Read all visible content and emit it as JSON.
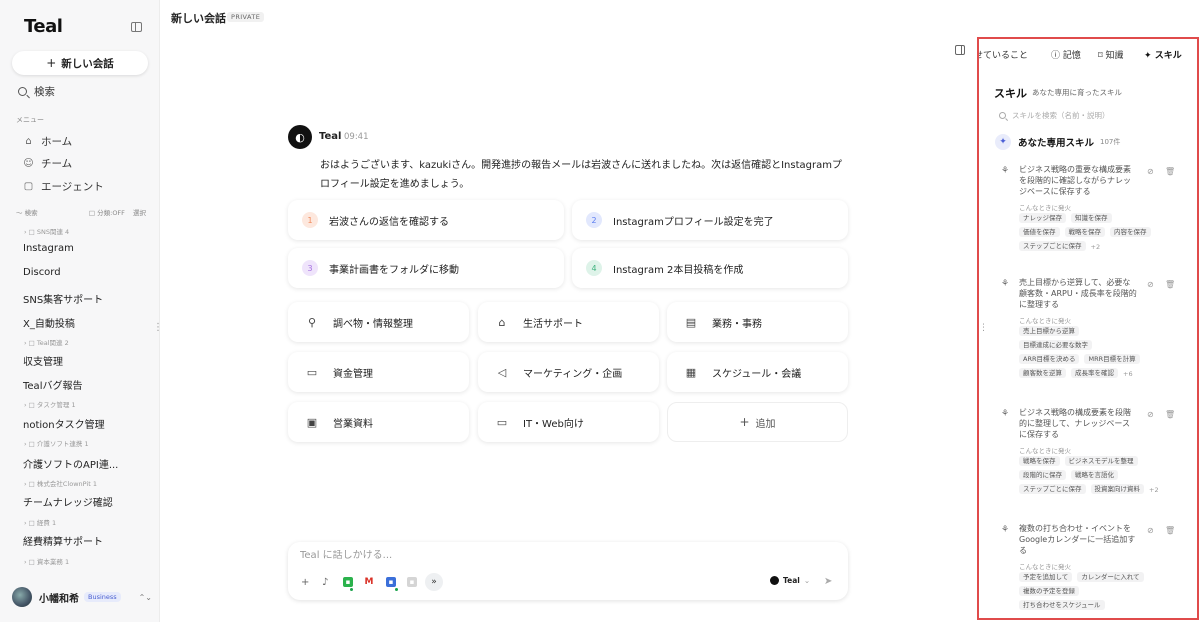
{
  "sidebar": {
    "logo": "Teal",
    "new_chat_label": "新しい会話",
    "search_label": "検索",
    "menu_label": "メニュー",
    "nav": [
      {
        "label": "ホーム",
        "icon": "home-icon"
      },
      {
        "label": "チーム",
        "icon": "team-icon"
      },
      {
        "label": "エージェント",
        "icon": "agent-icon"
      }
    ],
    "folder_header": {
      "label": "〜 検索",
      "category_off": "□ 分類:OFF",
      "select": "選択"
    },
    "items": [
      {
        "type": "group",
        "label": "› □ SNS関連 4"
      },
      {
        "type": "item",
        "label": "Instagram"
      },
      {
        "type": "item",
        "label": "Discord"
      },
      {
        "type": "item",
        "label": "SNS集客サポート"
      },
      {
        "type": "item",
        "label": "X_自動投稿"
      },
      {
        "type": "group",
        "label": "› □ Teal関連 2"
      },
      {
        "type": "item",
        "label": "収支管理"
      },
      {
        "type": "item",
        "label": "Tealバグ報告"
      },
      {
        "type": "group",
        "label": "› □ タスク管理 1"
      },
      {
        "type": "item",
        "label": "notionタスク管理"
      },
      {
        "type": "group",
        "label": "› □ 介護ソフト連携 1"
      },
      {
        "type": "item",
        "label": "介護ソフトのAPI連..."
      },
      {
        "type": "group",
        "label": "› □ 株式会社ClownPit 1"
      },
      {
        "type": "item",
        "label": "チームナレッジ確認"
      },
      {
        "type": "group",
        "label": "› □ 経費 1"
      },
      {
        "type": "item",
        "label": "経費精算サポート"
      },
      {
        "type": "group",
        "label": "› □ 資本業務 1"
      }
    ],
    "user": {
      "name": "小幡和希",
      "plan": "Business"
    }
  },
  "header": {
    "title": "新しい会話",
    "visibility": "PRIVATE"
  },
  "message": {
    "sender": "Teal",
    "time": "09:41",
    "text": "おはようございます、kazukiさん。開発進捗の報告メールは岩波さんに送れましたね。次は返信確認とInstagramプロフィール設定を進めましょう。"
  },
  "tasks": [
    {
      "num": "1",
      "label": "岩波さんの返信を確認する",
      "color": "#f08a5d"
    },
    {
      "num": "2",
      "label": "Instagramプロフィール設定を完了",
      "color": "#5b7cf0"
    },
    {
      "num": "3",
      "label": "事業計画書をフォルダに移動",
      "color": "#a774e0"
    },
    {
      "num": "4",
      "label": "Instagram 2本目投稿を作成",
      "color": "#3fb27f"
    }
  ],
  "categories": [
    {
      "label": "調べ物・情報整理",
      "icon": "search-icon"
    },
    {
      "label": "生活サポート",
      "icon": "home-icon"
    },
    {
      "label": "業務・事務",
      "icon": "clipboard-icon"
    },
    {
      "label": "資金管理",
      "icon": "wallet-icon"
    },
    {
      "label": "マーケティング・企画",
      "icon": "megaphone-icon"
    },
    {
      "label": "スケジュール・会議",
      "icon": "calendar-icon"
    },
    {
      "label": "営業資料",
      "icon": "briefcase-icon"
    },
    {
      "label": "IT・Web向け",
      "icon": "laptop-icon"
    }
  ],
  "add_label": "追加",
  "composer": {
    "placeholder": "Teal に話しかける...",
    "model": "Teal"
  },
  "right_panel": {
    "tabs": [
      {
        "label": "任せていること",
        "active": false
      },
      {
        "label": "記憶",
        "active": false
      },
      {
        "label": "知識",
        "active": false
      },
      {
        "label": "スキル",
        "active": true
      }
    ],
    "title": "スキル",
    "subtitle": "あなた専用に育ったスキル",
    "search_placeholder": "スキルを検索（名前・説明）",
    "section": {
      "title": "あなた専用スキル",
      "count": "107件"
    },
    "when_label": "こんなときに発火",
    "skills": [
      {
        "desc": "ビジネス戦略の重要な構成要素を段階的に確認しながらナレッジベースに保存する",
        "tags": [
          "ナレッジ保存",
          "知識を保存",
          "価値を保存",
          "戦略を保存",
          "内容を保存",
          "ステップごとに保存"
        ],
        "more": "+2"
      },
      {
        "desc": "売上目標から逆算して、必要な顧客数・ARPU・成長率を段階的に整理する",
        "tags": [
          "売上目標から逆算",
          "目標達成に必要な数字",
          "ARR目標を決める",
          "MRR目標を計算",
          "顧客数を逆算",
          "成長率を確認"
        ],
        "more": "+6"
      },
      {
        "desc": "ビジネス戦略の構成要素を段階的に整理して、ナレッジベースに保存する",
        "tags": [
          "戦略を保存",
          "ビジネスモデルを整理",
          "段階的に保存",
          "戦略を言語化",
          "ステップごとに保存",
          "投資案向け資料"
        ],
        "more": "+2"
      },
      {
        "desc": "複数の打ち合わせ・イベントをGoogleカレンダーに一括追加する",
        "tags": [
          "予定を追加して",
          "カレンダーに入れて",
          "複数の予定を登録",
          "打ち合わせをスケジュール"
        ],
        "more": ""
      }
    ]
  },
  "colors": {
    "accent": "#4b5fd6",
    "highlight_border": "#e04b4b"
  }
}
